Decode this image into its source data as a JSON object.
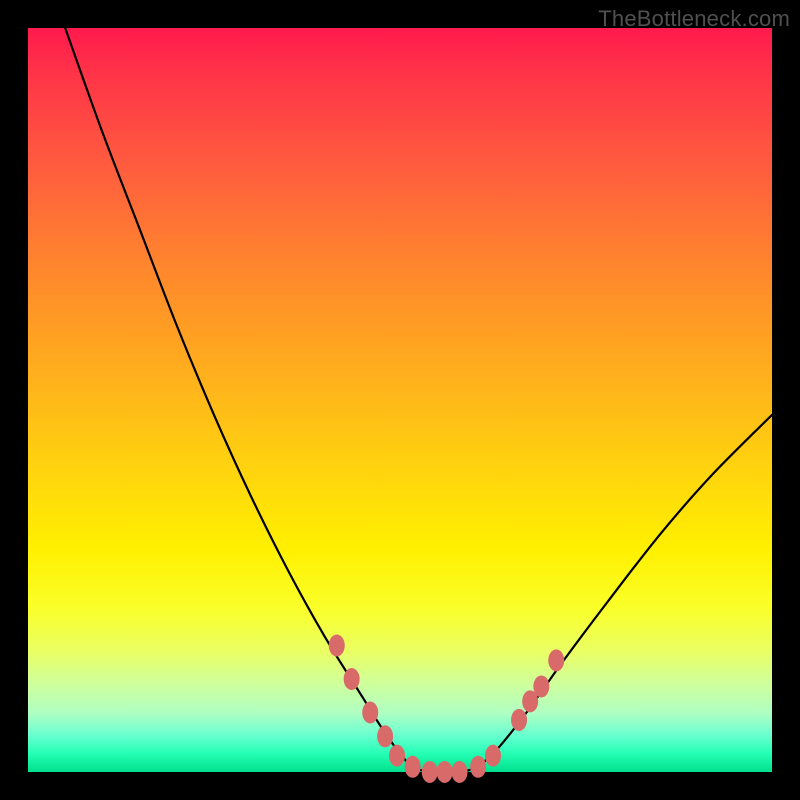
{
  "watermark": "TheBottleneck.com",
  "colors": {
    "curve": "#000000",
    "marker_fill": "#d86a6a",
    "marker_stroke": "#c85858"
  },
  "chart_data": {
    "type": "line",
    "title": "",
    "xlabel": "",
    "ylabel": "",
    "xlim": [
      0,
      100
    ],
    "ylim": [
      0,
      100
    ],
    "grid": false,
    "legend": false,
    "series": [
      {
        "name": "curve",
        "x": [
          5,
          10,
          15,
          20,
          25,
          30,
          35,
          40,
          45,
          47.5,
          50,
          52,
          55,
          57,
          60,
          63,
          67,
          72,
          78,
          85,
          92,
          100
        ],
        "y": [
          100,
          86,
          73,
          60,
          48,
          37,
          27,
          18,
          10,
          6,
          2.5,
          0.5,
          0,
          0,
          0.5,
          3,
          8,
          15,
          23,
          32,
          40,
          48
        ]
      }
    ],
    "markers": [
      {
        "x": 41.5,
        "y": 17
      },
      {
        "x": 43.5,
        "y": 12.5
      },
      {
        "x": 46,
        "y": 8
      },
      {
        "x": 48,
        "y": 4.8
      },
      {
        "x": 49.6,
        "y": 2.2
      },
      {
        "x": 51.7,
        "y": 0.7
      },
      {
        "x": 54,
        "y": 0
      },
      {
        "x": 56,
        "y": 0
      },
      {
        "x": 58,
        "y": 0
      },
      {
        "x": 60.5,
        "y": 0.7
      },
      {
        "x": 62.5,
        "y": 2.2
      },
      {
        "x": 66,
        "y": 7
      },
      {
        "x": 67.5,
        "y": 9.5
      },
      {
        "x": 69,
        "y": 11.5
      },
      {
        "x": 71,
        "y": 15
      }
    ]
  }
}
